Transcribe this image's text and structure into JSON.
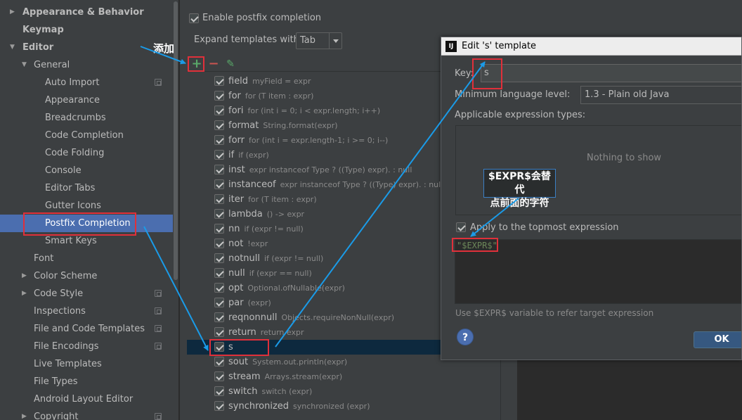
{
  "sidebar": {
    "items": [
      {
        "label": "Appearance & Behavior",
        "indent": 0,
        "bold": true,
        "arrow": "right",
        "project_icon": false
      },
      {
        "label": "Keymap",
        "indent": 0,
        "bold": true,
        "arrow": "",
        "project_icon": false
      },
      {
        "label": "Editor",
        "indent": 0,
        "bold": true,
        "arrow": "down",
        "project_icon": false
      },
      {
        "label": "General",
        "indent": 1,
        "bold": false,
        "arrow": "down",
        "project_icon": false
      },
      {
        "label": "Auto Import",
        "indent": 2,
        "bold": false,
        "arrow": "",
        "project_icon": true
      },
      {
        "label": "Appearance",
        "indent": 2,
        "bold": false,
        "arrow": "",
        "project_icon": false
      },
      {
        "label": "Breadcrumbs",
        "indent": 2,
        "bold": false,
        "arrow": "",
        "project_icon": false
      },
      {
        "label": "Code Completion",
        "indent": 2,
        "bold": false,
        "arrow": "",
        "project_icon": false
      },
      {
        "label": "Code Folding",
        "indent": 2,
        "bold": false,
        "arrow": "",
        "project_icon": false
      },
      {
        "label": "Console",
        "indent": 2,
        "bold": false,
        "arrow": "",
        "project_icon": false
      },
      {
        "label": "Editor Tabs",
        "indent": 2,
        "bold": false,
        "arrow": "",
        "project_icon": false
      },
      {
        "label": "Gutter Icons",
        "indent": 2,
        "bold": false,
        "arrow": "",
        "project_icon": false
      },
      {
        "label": "Postfix Completion",
        "indent": 2,
        "bold": false,
        "arrow": "",
        "project_icon": false,
        "selected": true
      },
      {
        "label": "Smart Keys",
        "indent": 2,
        "bold": false,
        "arrow": "",
        "project_icon": false
      },
      {
        "label": "Font",
        "indent": 1,
        "bold": false,
        "arrow": "",
        "project_icon": false
      },
      {
        "label": "Color Scheme",
        "indent": 1,
        "bold": false,
        "arrow": "right",
        "project_icon": false
      },
      {
        "label": "Code Style",
        "indent": 1,
        "bold": false,
        "arrow": "right",
        "project_icon": true
      },
      {
        "label": "Inspections",
        "indent": 1,
        "bold": false,
        "arrow": "",
        "project_icon": true
      },
      {
        "label": "File and Code Templates",
        "indent": 1,
        "bold": false,
        "arrow": "",
        "project_icon": true
      },
      {
        "label": "File Encodings",
        "indent": 1,
        "bold": false,
        "arrow": "",
        "project_icon": true
      },
      {
        "label": "Live Templates",
        "indent": 1,
        "bold": false,
        "arrow": "",
        "project_icon": false
      },
      {
        "label": "File Types",
        "indent": 1,
        "bold": false,
        "arrow": "",
        "project_icon": false
      },
      {
        "label": "Android Layout Editor",
        "indent": 1,
        "bold": false,
        "arrow": "",
        "project_icon": false
      },
      {
        "label": "Copyright",
        "indent": 1,
        "bold": false,
        "arrow": "right",
        "project_icon": true
      }
    ]
  },
  "postfix": {
    "enable_label": "Enable postfix completion",
    "expand_label": "Expand templates with",
    "expand_value": "Tab",
    "add_symbol": "+",
    "remove_symbol": "−",
    "edit_symbol": "✎",
    "templates": [
      {
        "name": "field",
        "example": "myField = expr"
      },
      {
        "name": "for",
        "example": "for (T item : expr)"
      },
      {
        "name": "fori",
        "example": "for (int i = 0; i < expr.length; i++)"
      },
      {
        "name": "format",
        "example": "String.format(expr)"
      },
      {
        "name": "forr",
        "example": "for (int i = expr.length-1; i >= 0; i--)"
      },
      {
        "name": "if",
        "example": "if (expr)"
      },
      {
        "name": "inst",
        "example": "expr instanceof Type ? ((Type) expr). : null"
      },
      {
        "name": "instanceof",
        "example": "expr instanceof Type ? ((Type) expr). : null"
      },
      {
        "name": "iter",
        "example": "for (T item : expr)"
      },
      {
        "name": "lambda",
        "example": "() -> expr"
      },
      {
        "name": "nn",
        "example": "if (expr != null)"
      },
      {
        "name": "not",
        "example": "!expr"
      },
      {
        "name": "notnull",
        "example": "if (expr != null)"
      },
      {
        "name": "null",
        "example": "if (expr == null)"
      },
      {
        "name": "opt",
        "example": "Optional.ofNullable(expr)"
      },
      {
        "name": "par",
        "example": "(expr)"
      },
      {
        "name": "reqnonnull",
        "example": "Objects.requireNonNull(expr)"
      },
      {
        "name": "return",
        "example": "return expr"
      },
      {
        "name": "s",
        "example": "",
        "selected": true
      },
      {
        "name": "sout",
        "example": "System.out.println(expr)"
      },
      {
        "name": "stream",
        "example": "Arrays.stream(expr)"
      },
      {
        "name": "switch",
        "example": "switch (expr)"
      },
      {
        "name": "synchronized",
        "example": "synchronized (expr)"
      }
    ]
  },
  "dialog": {
    "title": "Edit 's' template",
    "logo": "IJ",
    "key_label": "Key:",
    "key_value": "s",
    "min_lang_label": "Minimum language level:",
    "min_lang_value": "1.3 - Plain old Java",
    "applicable_label": "Applicable expression types:",
    "nothing_to_show": "Nothing to show",
    "apply_topmost_label": "Apply to the topmost expression",
    "template_text": "\"$EXPR$\"",
    "hint": "Use $EXPR$ variable to refer target expression",
    "help_symbol": "?",
    "ok_label": "OK"
  },
  "annotations": {
    "add_note": "添加",
    "expr_note_line1": "$EXPR$会替代",
    "expr_note_line2": "点前面的字符"
  },
  "colors": {
    "background": "#3c3f41",
    "selection": "#4b6eaf",
    "list_selection": "#0d293e",
    "annotation_red": "#e0303a",
    "annotation_blue": "#1a9be8",
    "string_green": "#6a8759",
    "add_green": "#59a869",
    "remove_red": "#c75450"
  }
}
